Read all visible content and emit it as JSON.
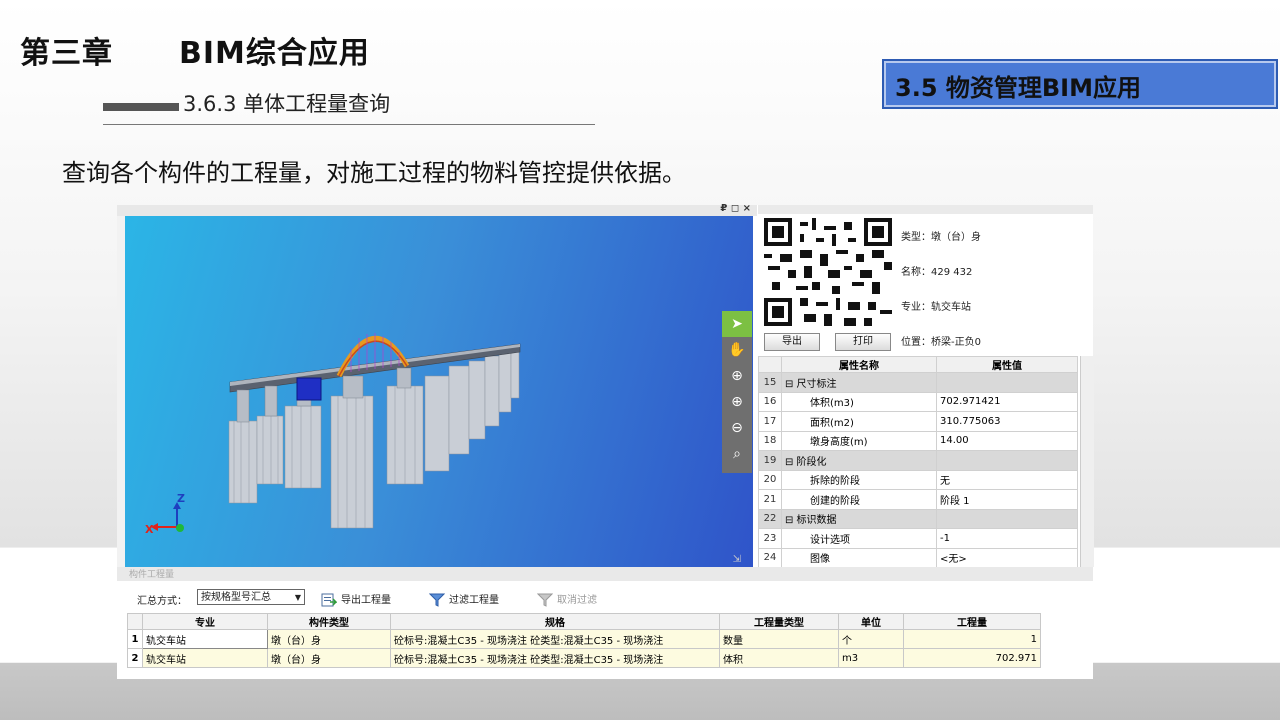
{
  "slide": {
    "chapter_no": "第三章",
    "chapter_title": "BIM综合应用",
    "subtitle": "3.6.3 单体工程量查询",
    "section": "3.5 物资管理BIM应用",
    "description": "查询各个构件的工程量，对施工过程的物料管控提供依据。"
  },
  "viewport": {
    "window_controls": "₽ ◻ ×",
    "axis_x": "X",
    "axis_z": "Z",
    "tools": [
      "select-icon",
      "pan-icon",
      "orbit-icon",
      "zoom-in-icon",
      "zoom-out-icon",
      "zoom-fit-icon"
    ]
  },
  "info": {
    "type": "类型：墩（台）身",
    "name": "名称：429 432",
    "discipline": "专业：轨交车站",
    "location": "位置：桥梁-正负0",
    "export_label": "导出",
    "print_label": "打印"
  },
  "properties": {
    "header_name": "属性名称",
    "header_value": "属性值",
    "rows": [
      {
        "no": "15",
        "group": true,
        "name": "⊟ 尺寸标注",
        "value": ""
      },
      {
        "no": "16",
        "group": false,
        "name": "体积(m3)",
        "value": "702.971421"
      },
      {
        "no": "17",
        "group": false,
        "name": "面积(m2)",
        "value": "310.775063"
      },
      {
        "no": "18",
        "group": false,
        "name": "墩身高度(m)",
        "value": "14.00"
      },
      {
        "no": "19",
        "group": true,
        "name": "⊟ 阶段化",
        "value": ""
      },
      {
        "no": "20",
        "group": false,
        "name": "拆除的阶段",
        "value": "无"
      },
      {
        "no": "21",
        "group": false,
        "name": "创建的阶段",
        "value": "阶段 1"
      },
      {
        "no": "22",
        "group": true,
        "name": "⊟ 标识数据",
        "value": ""
      },
      {
        "no": "23",
        "group": false,
        "name": "设计选项",
        "value": "-1"
      },
      {
        "no": "24",
        "group": false,
        "name": "图像",
        "value": "<无>"
      }
    ]
  },
  "quantity": {
    "panel_title": "构件工程量",
    "summary_label": "汇总方式：",
    "summary_value": "按规格型号汇总",
    "export_label": "导出工程量",
    "filter_label": "过滤工程量",
    "cancel_filter_label": "取消过滤",
    "columns": [
      "专业",
      "构件类型",
      "规格",
      "工程量类型",
      "单位",
      "工程量"
    ],
    "rows": [
      {
        "idx": "1",
        "cells": [
          "轨交车站",
          "墩（台）身",
          "砼标号:混凝土C35 - 现场浇注   砼类型:混凝土C35 - 现场浇注",
          "数量",
          "个",
          "1"
        ]
      },
      {
        "idx": "2",
        "cells": [
          "轨交车站",
          "墩（台）身",
          "砼标号:混凝土C35 - 现场浇注   砼类型:混凝土C35 - 现场浇注",
          "体积",
          "m3",
          "702.971"
        ]
      }
    ]
  },
  "colors": {
    "section_box": "#4a7ad6",
    "toolbar_active": "#7cc043",
    "axis_x": "#e0231b",
    "axis_z": "#1e3fbf"
  }
}
